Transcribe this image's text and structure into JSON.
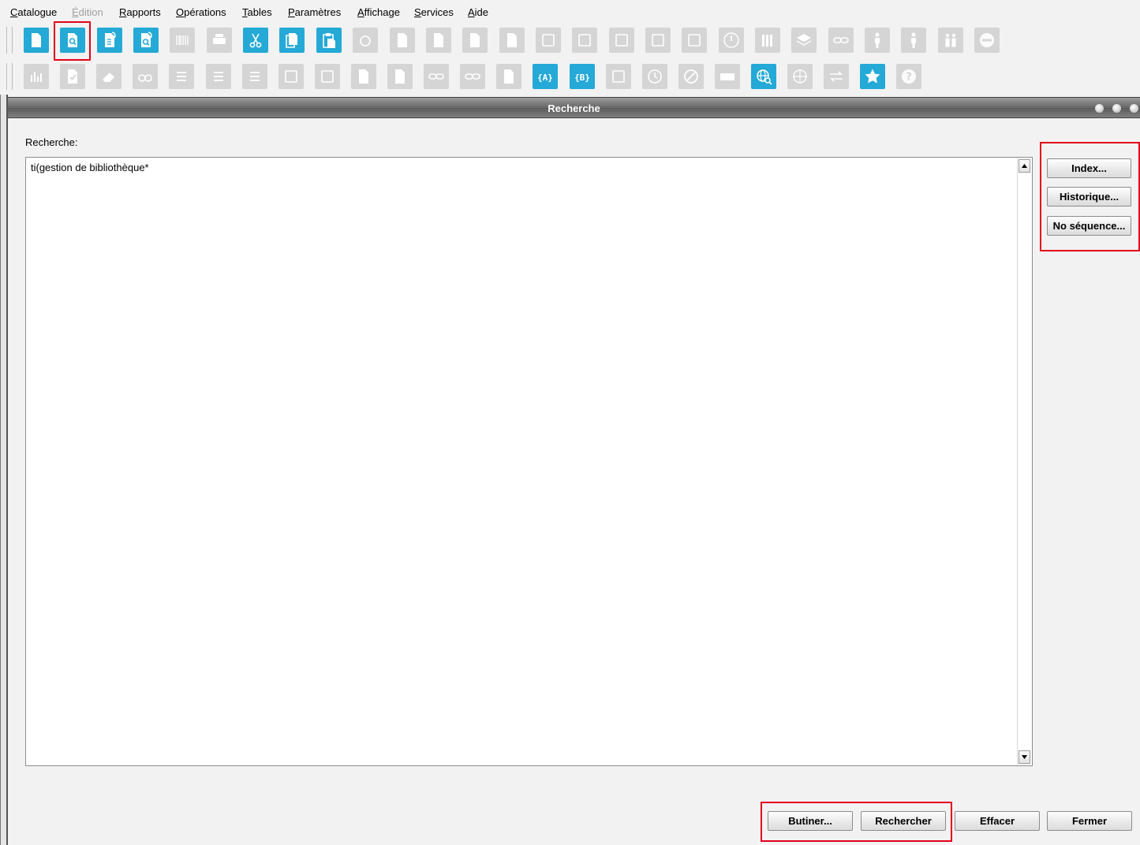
{
  "menu": {
    "items": [
      {
        "label": "Catalogue",
        "disabled": false
      },
      {
        "label": "Édition",
        "disabled": true
      },
      {
        "label": "Rapports",
        "disabled": false
      },
      {
        "label": "Opérations",
        "disabled": false
      },
      {
        "label": "Tables",
        "disabled": false
      },
      {
        "label": "Paramètres",
        "disabled": false
      },
      {
        "label": "Affichage",
        "disabled": false
      },
      {
        "label": "Services",
        "disabled": false
      },
      {
        "label": "Aide",
        "disabled": false
      }
    ]
  },
  "toolbar1": {
    "buttons": [
      {
        "icon": "new-document-icon",
        "enabled": true
      },
      {
        "icon": "search-document-icon",
        "enabled": true,
        "highlighted": true
      },
      {
        "icon": "document-refresh-icon",
        "enabled": true
      },
      {
        "icon": "document-search-refresh-icon",
        "enabled": true
      },
      {
        "icon": "barcode-icon",
        "enabled": false
      },
      {
        "icon": "print-icon",
        "enabled": false
      },
      {
        "icon": "cut-icon",
        "enabled": true
      },
      {
        "icon": "copy-icon",
        "enabled": true
      },
      {
        "icon": "paste-icon",
        "enabled": true
      },
      {
        "icon": "camera-icon",
        "enabled": false
      },
      {
        "icon": "save-document-icon",
        "enabled": false
      },
      {
        "icon": "document-settings-icon",
        "enabled": false
      },
      {
        "icon": "delete-document-icon",
        "enabled": false
      },
      {
        "icon": "document-list-icon",
        "enabled": false
      },
      {
        "icon": "window-icon",
        "enabled": false
      },
      {
        "icon": "export-icon",
        "enabled": false
      },
      {
        "icon": "add-icon",
        "enabled": false
      },
      {
        "icon": "refresh-icon",
        "enabled": false
      },
      {
        "icon": "close-box-icon",
        "enabled": false
      },
      {
        "icon": "power-icon",
        "enabled": false
      },
      {
        "icon": "books-icon",
        "enabled": false
      },
      {
        "icon": "layers-icon",
        "enabled": false
      },
      {
        "icon": "link-icon",
        "enabled": false
      },
      {
        "icon": "person-icon",
        "enabled": false
      },
      {
        "icon": "person-alt-icon",
        "enabled": false
      },
      {
        "icon": "people-icon",
        "enabled": false
      },
      {
        "icon": "no-entry-icon",
        "enabled": false
      }
    ]
  },
  "toolbar2": {
    "buttons": [
      {
        "icon": "chart-icon",
        "enabled": false
      },
      {
        "icon": "checklist-icon",
        "enabled": false
      },
      {
        "icon": "eraser-icon",
        "enabled": false
      },
      {
        "icon": "binoculars-icon",
        "enabled": false
      },
      {
        "icon": "list-icon",
        "enabled": false
      },
      {
        "icon": "list-alt-icon",
        "enabled": false
      },
      {
        "icon": "list-lines-icon",
        "enabled": false
      },
      {
        "icon": "excel-icon",
        "enabled": false
      },
      {
        "icon": "save-icon",
        "enabled": false
      },
      {
        "icon": "document-copy-icon",
        "enabled": false
      },
      {
        "icon": "document-edit-icon",
        "enabled": false
      },
      {
        "icon": "link-chain-icon",
        "enabled": false
      },
      {
        "icon": "unlink-icon",
        "enabled": false
      },
      {
        "icon": "add-document-icon",
        "enabled": false
      },
      {
        "icon": "set-a-icon",
        "enabled": true,
        "text": "{A}"
      },
      {
        "icon": "set-b-icon",
        "enabled": true,
        "text": "{B}"
      },
      {
        "icon": "edit-icon",
        "enabled": false
      },
      {
        "icon": "clock-icon",
        "enabled": false
      },
      {
        "icon": "forbidden-icon",
        "enabled": false
      },
      {
        "icon": "keyboard-icon",
        "enabled": false
      },
      {
        "icon": "globe-search-icon",
        "enabled": true
      },
      {
        "icon": "globe-icon",
        "enabled": false
      },
      {
        "icon": "swap-icon",
        "enabled": false
      },
      {
        "icon": "star-icon",
        "enabled": true
      },
      {
        "icon": "help-icon",
        "enabled": false
      }
    ]
  },
  "window": {
    "title": "Recherche"
  },
  "search": {
    "label": "Recherche:",
    "query": "ti(gestion de bibliothèque*"
  },
  "side_buttons": {
    "index": "Index...",
    "history": "Historique...",
    "sequence": "No séquence..."
  },
  "bottom_buttons": {
    "browse": "Butiner...",
    "search": "Rechercher",
    "clear": "Effacer",
    "close": "Fermer"
  },
  "colors": {
    "accent": "#25a9d6",
    "disabled_icon": "#d5d5d5",
    "highlight": "#e3001b"
  }
}
